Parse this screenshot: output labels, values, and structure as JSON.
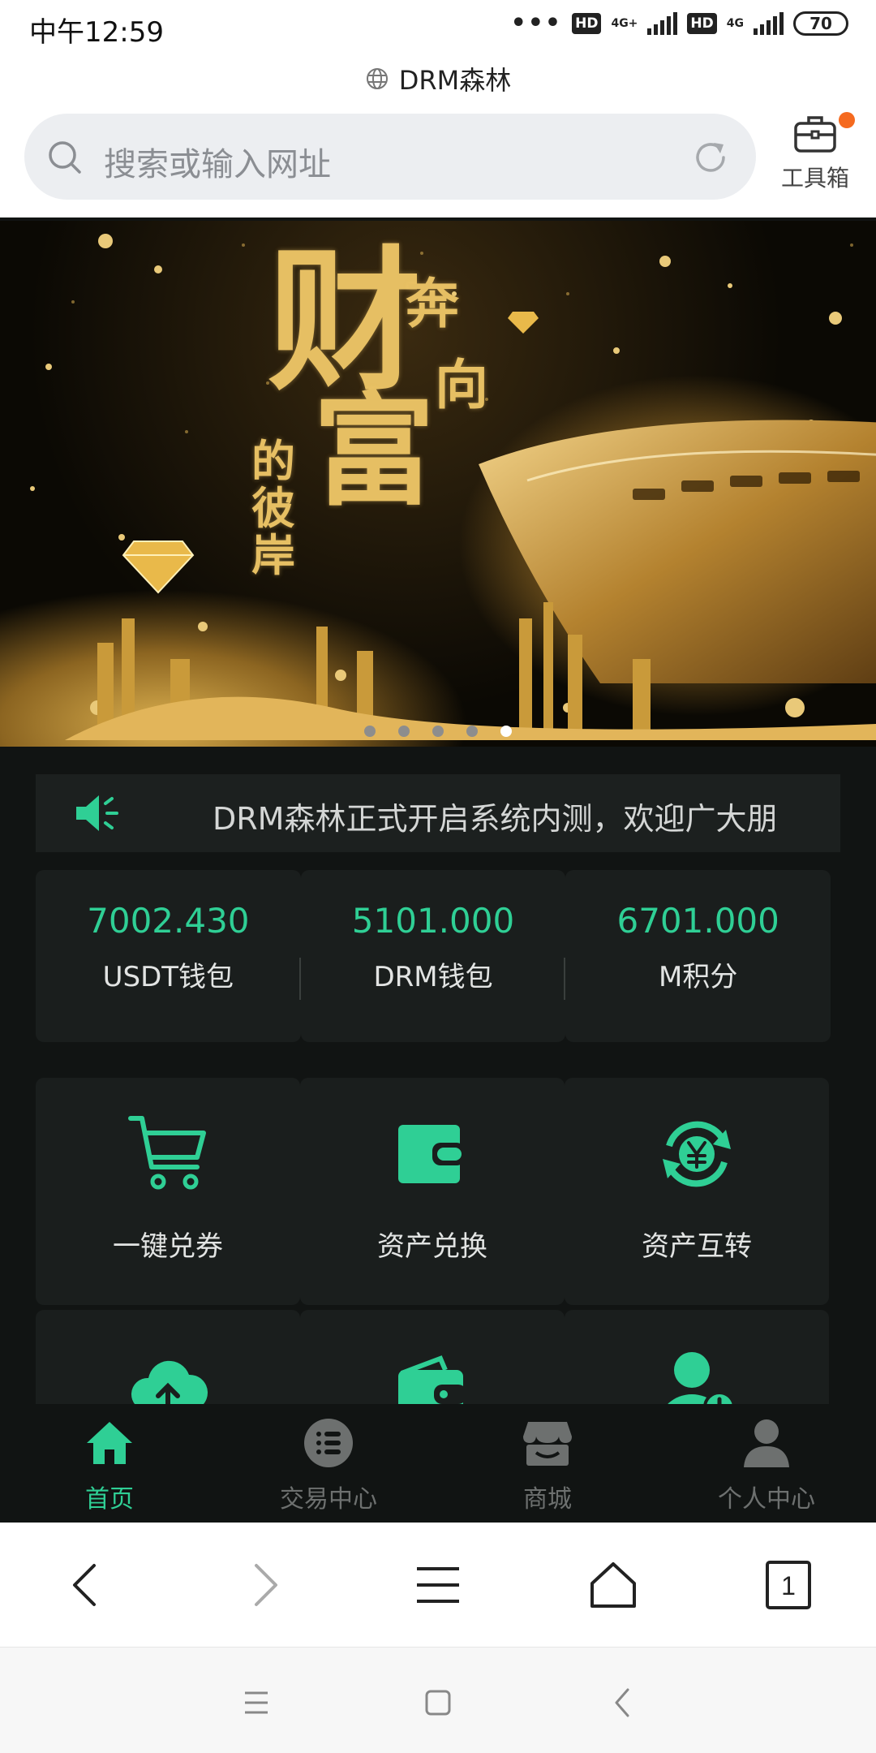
{
  "status": {
    "time": "中午12:59",
    "hd1": "HD",
    "net1": "4G+",
    "hd2": "HD",
    "net2": "4G",
    "battery": "70"
  },
  "page_title": "DRM森林",
  "address_bar": {
    "placeholder": "搜索或输入网址"
  },
  "toolbox": {
    "label": "工具箱"
  },
  "banner": {
    "headline": [
      "财",
      "富",
      "的",
      "彼",
      "岸",
      "奔",
      "向"
    ],
    "slide_count": 5,
    "active_slide": 5
  },
  "notice": {
    "text": "DRM森林正式开启系统内测，欢迎广大朋"
  },
  "balances": [
    {
      "value": "7002.430",
      "label": "USDT钱包"
    },
    {
      "value": "5101.000",
      "label": "DRM钱包"
    },
    {
      "value": "6701.000",
      "label": "M积分"
    }
  ],
  "actions": [
    {
      "label": "一键兑券",
      "icon": "cart-icon"
    },
    {
      "label": "资产兑换",
      "icon": "wallet-icon"
    },
    {
      "label": "资产互转",
      "icon": "yen-exchange-icon"
    },
    {
      "label": "",
      "icon": "cloud-upload-icon"
    },
    {
      "label": "",
      "icon": "wallet-icon"
    },
    {
      "label": "",
      "icon": "add-user-icon"
    }
  ],
  "tabs": [
    {
      "label": "首页",
      "icon": "home-icon",
      "active": true
    },
    {
      "label": "交易中心",
      "icon": "list-icon",
      "active": false
    },
    {
      "label": "商城",
      "icon": "store-icon",
      "active": false
    },
    {
      "label": "个人中心",
      "icon": "user-icon",
      "active": false
    }
  ],
  "browser_nav": {
    "tabs_count": "1"
  },
  "colors": {
    "accent": "#2fcf95",
    "background": "#111413",
    "card": "#1a1e1d",
    "notification_dot": "#f56a1f"
  }
}
